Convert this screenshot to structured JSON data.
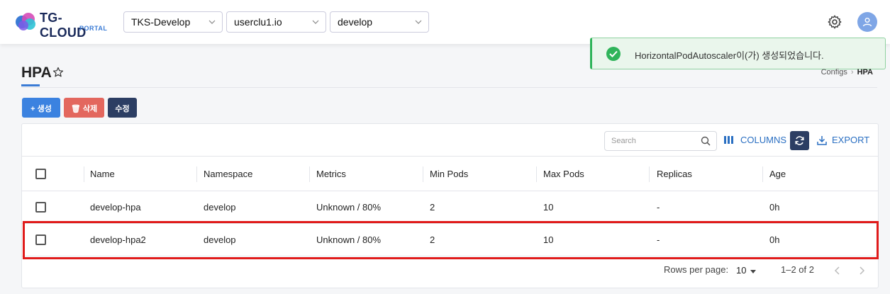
{
  "header": {
    "logo_title": "TG-CLOUD",
    "logo_sub": "PORTAL",
    "selectors": [
      {
        "value": "TKS-Develop"
      },
      {
        "value": "userclu1.io"
      },
      {
        "value": "develop"
      }
    ]
  },
  "toast": {
    "message": "HorizontalPodAutoscaler이(가) 생성되었습니다.",
    "status_color": "#2fb45a"
  },
  "page": {
    "title": "HPA",
    "breadcrumb": {
      "parent": "Configs",
      "current": "HPA"
    }
  },
  "actions": {
    "create_label": "생성",
    "delete_label": "삭제",
    "edit_label": "수정"
  },
  "toolbar": {
    "search_placeholder": "Search",
    "columns_label": "COLUMNS",
    "export_label": "EXPORT"
  },
  "table": {
    "columns": [
      "Name",
      "Namespace",
      "Metrics",
      "Min Pods",
      "Max Pods",
      "Replicas",
      "Age"
    ],
    "rows": [
      {
        "name": "develop-hpa",
        "namespace": "develop",
        "metrics": "Unknown / 80%",
        "min_pods": "2",
        "max_pods": "10",
        "replicas": "-",
        "age": "0h"
      },
      {
        "name": "develop-hpa2",
        "namespace": "develop",
        "metrics": "Unknown / 80%",
        "min_pods": "2",
        "max_pods": "10",
        "replicas": "-",
        "age": "0h"
      }
    ]
  },
  "pagination": {
    "rows_per_page_label": "Rows per page:",
    "rows_per_page_value": "10",
    "range": "1–2 of 2"
  },
  "colors": {
    "primary": "#3b82e0",
    "danger": "#e3675e",
    "dark": "#2c3e63",
    "highlight": "#e01b1b"
  }
}
